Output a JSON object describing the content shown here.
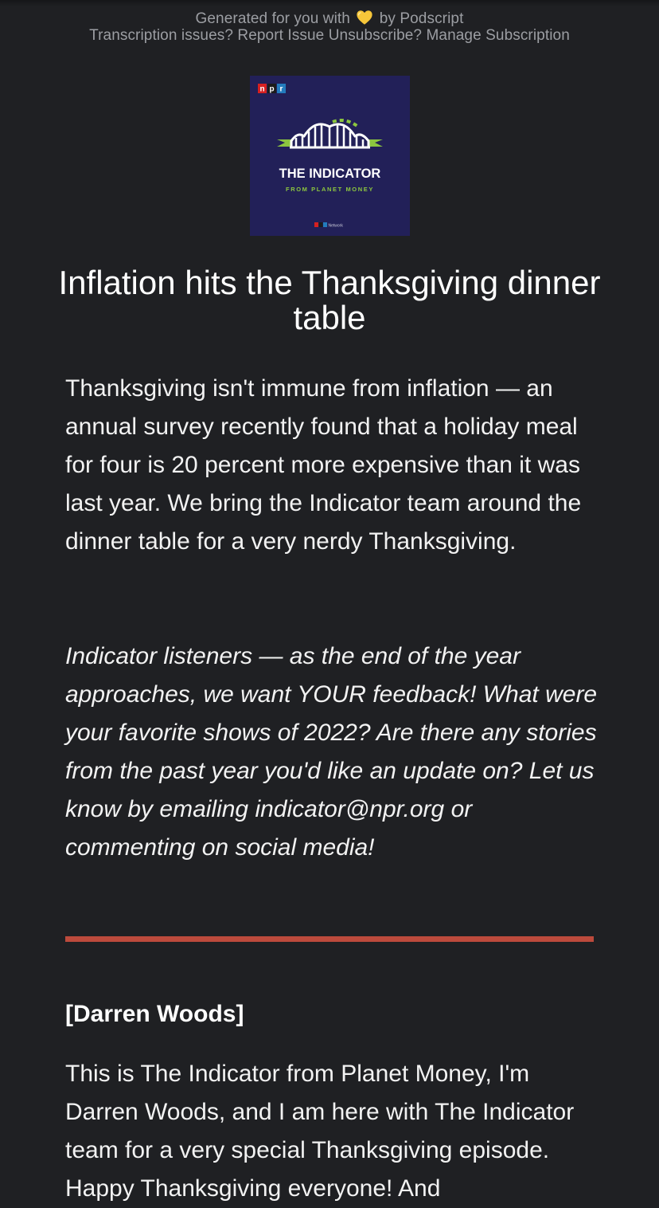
{
  "header": {
    "generated_prefix": "Generated for you with",
    "heart_icon": "yellow-heart-icon",
    "generated_suffix": "by Podscript",
    "transcription_issues": "Transcription issues?",
    "report_issue_link": "Report Issue",
    "unsubscribe_question": "Unsubscribe?",
    "manage_subscription_link": "Manage Subscription"
  },
  "artwork": {
    "npr_badge": "npr",
    "show_name": "THE INDICATOR",
    "show_subtitle": "FROM PLANET MONEY",
    "network_badge": "npr",
    "network_label": "Network",
    "colors": {
      "background": "#222058",
      "accent_green": "#8cc63f",
      "npr_red": "#d62021",
      "npr_blue": "#237bbd"
    }
  },
  "episode": {
    "title": "Inflation hits the Thanksgiving dinner table",
    "description": "Thanksgiving isn't immune from inflation — an annual survey recently found that a holiday meal for four is 20 percent more expensive than it was last year. We bring the Indicator team around the dinner table for a very nerdy Thanksgiving.",
    "listener_note": "Indicator listeners — as the end of the year approaches, we want YOUR feedback! What were your favorite shows of 2022? Are there any stories from the past year you'd like an update on? Let us know by emailing indicator@npr.org or commenting on social media!"
  },
  "divider_color": "#bc4a3c",
  "transcript": {
    "speaker": "[Darren Woods]",
    "text": "This is The Indicator from Planet Money, I'm Darren Woods, and I am here with The Indicator team for a very special Thanksgiving episode. Happy Thanksgiving everyone! And"
  }
}
